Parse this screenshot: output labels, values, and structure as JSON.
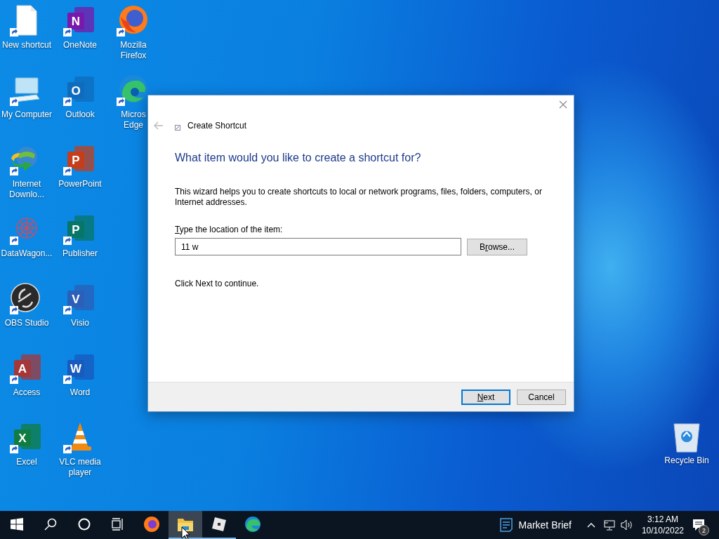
{
  "desktop": {
    "columns": [
      [
        {
          "label": "New shortcut",
          "kind": "file"
        },
        {
          "label": "My Computer",
          "kind": "computer"
        },
        {
          "label": "Internet Downlo...",
          "kind": "idm"
        },
        {
          "label": "DataWagon...",
          "kind": "datawagon"
        },
        {
          "label": "OBS Studio",
          "kind": "obs"
        },
        {
          "label": "Access",
          "kind": "access",
          "letter": "A"
        },
        {
          "label": "Excel",
          "kind": "excel",
          "letter": "X"
        }
      ],
      [
        {
          "label": "OneNote",
          "kind": "onenote",
          "letter": "N"
        },
        {
          "label": "Outlook",
          "kind": "outlook",
          "letter": "O"
        },
        {
          "label": "PowerPoint",
          "kind": "powerpoint",
          "letter": "P"
        },
        {
          "label": "Publisher",
          "kind": "publisher",
          "letter": "P"
        },
        {
          "label": "Visio",
          "kind": "visio",
          "letter": "V"
        },
        {
          "label": "Word",
          "kind": "word",
          "letter": "W"
        },
        {
          "label": "VLC media player",
          "kind": "vlc"
        }
      ],
      [
        {
          "label": "Mozilla Firefox",
          "kind": "firefox"
        },
        {
          "label": "Micros\nEdge",
          "kind": "edge"
        }
      ]
    ],
    "recycle_bin": {
      "label": "Recycle Bin"
    }
  },
  "dialog": {
    "title": "Create Shortcut",
    "back_disabled": true,
    "heading": "What item would you like to create a shortcut for?",
    "description": "This wizard helps you to create shortcuts to local or network programs, files, folders, computers, or Internet addresses.",
    "location_label": {
      "key": "T",
      "post": "ype the location of the item:"
    },
    "location_value": "11 w",
    "browse_button": {
      "pre": "B",
      "key": "r",
      "post": "owse..."
    },
    "hint": "Click Next to continue.",
    "buttons": [
      {
        "key": "N",
        "post": "ext",
        "default": true
      },
      {
        "pre": "Cancel",
        "default": false
      }
    ]
  },
  "taskbar": {
    "items": [
      {
        "kind": "start",
        "active": false,
        "running": false
      },
      {
        "kind": "search",
        "active": false,
        "running": false
      },
      {
        "kind": "cortana",
        "active": false,
        "running": false
      },
      {
        "kind": "taskview",
        "active": false,
        "running": false
      },
      {
        "kind": "firefox",
        "active": false,
        "running": false
      },
      {
        "kind": "explorer",
        "active": true,
        "running": true
      },
      {
        "kind": "roblox",
        "active": false,
        "running": true
      },
      {
        "kind": "edge",
        "active": false,
        "running": false
      }
    ],
    "news": "Market Brief",
    "time": "3:12 AM",
    "date": "10/10/2022",
    "notifications": "2"
  }
}
